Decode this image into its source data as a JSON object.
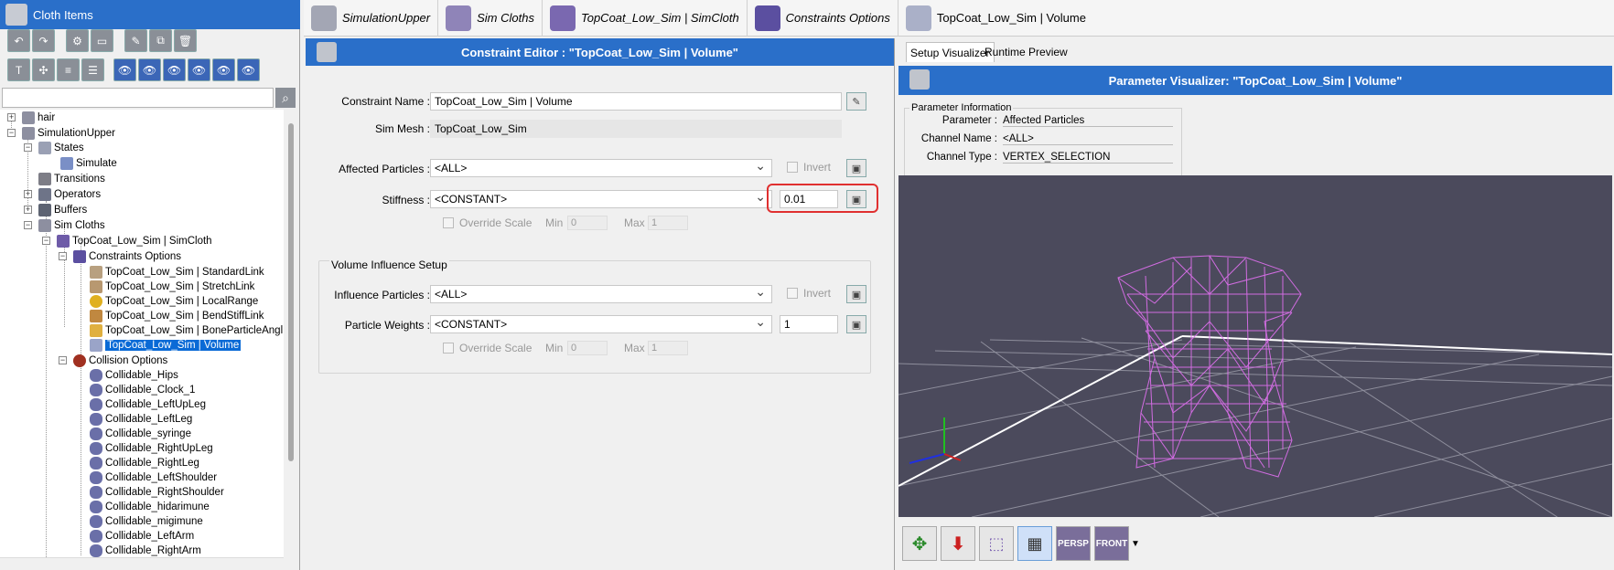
{
  "left_panel": {
    "title": "Cloth Items",
    "tree": [
      {
        "label": "hair"
      },
      {
        "label": "SimulationUpper"
      },
      {
        "label": "States"
      },
      {
        "label": "Simulate"
      },
      {
        "label": "Transitions"
      },
      {
        "label": "Operators"
      },
      {
        "label": "Buffers"
      },
      {
        "label": "Sim Cloths"
      },
      {
        "label": "TopCoat_Low_Sim | SimCloth"
      },
      {
        "label": "Constraints Options"
      },
      {
        "label": "TopCoat_Low_Sim | StandardLink"
      },
      {
        "label": "TopCoat_Low_Sim | StretchLink"
      },
      {
        "label": "TopCoat_Low_Sim | LocalRange"
      },
      {
        "label": "TopCoat_Low_Sim | BendStiffLink"
      },
      {
        "label": "TopCoat_Low_Sim | BoneParticleAngl"
      },
      {
        "label": "TopCoat_Low_Sim | Volume"
      },
      {
        "label": "Collision Options"
      },
      {
        "label": "Collidable_Hips"
      },
      {
        "label": "Collidable_Clock_1"
      },
      {
        "label": "Collidable_LeftUpLeg"
      },
      {
        "label": "Collidable_LeftLeg"
      },
      {
        "label": "Collidable_syringe"
      },
      {
        "label": "Collidable_RightUpLeg"
      },
      {
        "label": "Collidable_RightLeg"
      },
      {
        "label": "Collidable_LeftShoulder"
      },
      {
        "label": "Collidable_RightShoulder"
      },
      {
        "label": "Collidable_hidarimune"
      },
      {
        "label": "Collidable_migimune"
      },
      {
        "label": "Collidable_LeftArm"
      },
      {
        "label": "Collidable_RightArm"
      }
    ]
  },
  "breadcrumbs": [
    "SimulationUpper",
    "Sim Cloths",
    "TopCoat_Low_Sim | SimCloth",
    "Constraints Options",
    "TopCoat_Low_Sim | Volume"
  ],
  "constraint_editor": {
    "title": "Constraint Editor : \"TopCoat_Low_Sim | Volume\"",
    "constraint_name_label": "Constraint Name :",
    "constraint_name_value": "TopCoat_Low_Sim | Volume",
    "sim_mesh_label": "Sim Mesh :",
    "sim_mesh_value": "TopCoat_Low_Sim",
    "affected_particles_label": "Affected Particles :",
    "affected_particles_value": "<ALL>",
    "invert_label": "Invert",
    "stiffness_label": "Stiffness :",
    "stiffness_value": "<CONSTANT>",
    "stiffness_number": "0.01",
    "override_scale_label": "Override Scale",
    "min_label": "Min",
    "min_value": "0",
    "max_label": "Max",
    "max_value": "1",
    "volume_group_label": "Volume Influence Setup",
    "influence_particles_label": "Influence Particles :",
    "influence_particles_value": "<ALL>",
    "particle_weights_label": "Particle Weights :",
    "particle_weights_value": "<CONSTANT>",
    "particle_weights_number": "1"
  },
  "visualizer": {
    "tabs": [
      "Setup Visualizer",
      "Runtime Preview"
    ],
    "title": "Parameter Visualizer: \"TopCoat_Low_Sim | Volume\"",
    "info_group_label": "Parameter Information",
    "parameter_label": "Parameter :",
    "parameter_value": "Affected Particles",
    "channel_name_label": "Channel Name :",
    "channel_name_value": "<ALL>",
    "channel_type_label": "Channel Type :",
    "channel_type_value": "VERTEX_SELECTION",
    "toolbar": {
      "persp_label": "PERSP",
      "front_label": "FRONT"
    }
  },
  "colors": {
    "accent": "#2a6fc9",
    "mesh": "#e070f0",
    "viewport": "#4b4a5c",
    "highlight": "#e03030"
  }
}
